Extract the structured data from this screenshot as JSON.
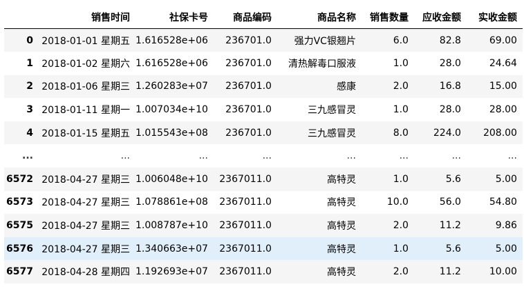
{
  "table": {
    "columns": [
      "",
      "销售时间",
      "社保卡号",
      "商品编码",
      "商品名称",
      "销售数量",
      "应收金额",
      "实收金额"
    ],
    "rows": [
      [
        "0",
        "2018-01-01 星期五",
        "1.616528e+06",
        "236701.0",
        "强力VC银翘片",
        "6.0",
        "82.8",
        "69.00"
      ],
      [
        "1",
        "2018-01-02 星期六",
        "1.616528e+06",
        "236701.0",
        "清热解毒口服液",
        "1.0",
        "28.0",
        "24.64"
      ],
      [
        "2",
        "2018-01-06 星期三",
        "1.260283e+07",
        "236701.0",
        "感康",
        "2.0",
        "16.8",
        "15.00"
      ],
      [
        "3",
        "2018-01-11 星期一",
        "1.007034e+10",
        "236701.0",
        "三九感冒灵",
        "1.0",
        "28.0",
        "28.00"
      ],
      [
        "4",
        "2018-01-15 星期五",
        "1.015543e+08",
        "236701.0",
        "三九感冒灵",
        "8.0",
        "224.0",
        "208.00"
      ],
      [
        "...",
        "...",
        "...",
        "...",
        "...",
        "...",
        "...",
        "..."
      ],
      [
        "6572",
        "2018-04-27 星期三",
        "1.006048e+10",
        "2367011.0",
        "高特灵",
        "1.0",
        "5.6",
        "5.00"
      ],
      [
        "6573",
        "2018-04-27 星期三",
        "1.078861e+08",
        "2367011.0",
        "高特灵",
        "10.0",
        "56.0",
        "54.80"
      ],
      [
        "6575",
        "2018-04-27 星期三",
        "1.008787e+10",
        "2367011.0",
        "高特灵",
        "2.0",
        "11.2",
        "9.86"
      ],
      [
        "6576",
        "2018-04-27 星期三",
        "1.340663e+07",
        "2367011.0",
        "高特灵",
        "1.0",
        "5.6",
        "5.00"
      ],
      [
        "6577",
        "2018-04-28 星期四",
        "1.192693e+07",
        "2367011.0",
        "高特灵",
        "2.0",
        "11.2",
        "10.00"
      ]
    ],
    "hovered_row_index": "6576"
  }
}
